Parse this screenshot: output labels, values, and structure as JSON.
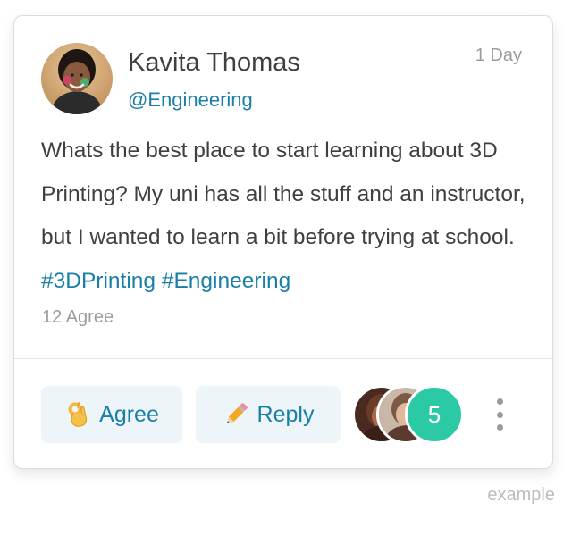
{
  "post": {
    "author_name": "Kavita Thomas",
    "handle": "@Engineering",
    "timestamp": "1 Day",
    "body_text": "Whats the best place to start learning about 3D Printing? My uni has all the stuff and an instructor, but I wanted to learn a bit before trying at school.",
    "hashtags": [
      "#3DPrinting",
      "#Engineering"
    ],
    "agree_count": "12 Agree"
  },
  "actions": {
    "agree": {
      "label": "Agree",
      "icon": "ok-hand-icon"
    },
    "reply": {
      "label": "Reply",
      "icon": "pencil-icon"
    }
  },
  "participants": {
    "more_count": "5",
    "more_color": "#2bc9a5"
  },
  "colors": {
    "accent": "#1a7fa8",
    "button_bg": "#eef5f9",
    "muted_text": "#9c9c9c",
    "body_text": "#3f3f3f"
  },
  "footer": {
    "watermark": "example"
  }
}
